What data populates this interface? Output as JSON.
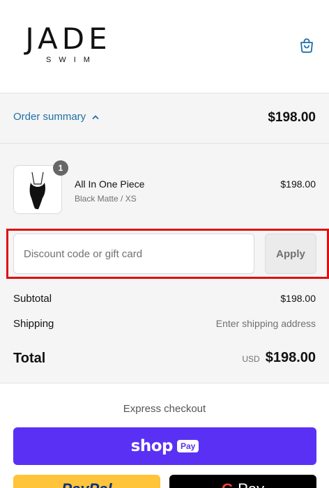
{
  "header": {
    "logo_main": "JADE",
    "logo_sub": "SWIM",
    "cart_icon": "shopping-bag-icon"
  },
  "summary": {
    "toggle_label": "Order summary",
    "toggle_icon": "chevron-up-icon",
    "total": "$198.00",
    "link_color": "#1f6fa8"
  },
  "product": {
    "quantity": "1",
    "name": "All In One Piece",
    "variant": "Black Matte / XS",
    "price": "$198.00",
    "image_icon": "swimsuit-icon"
  },
  "discount": {
    "placeholder": "Discount code or gift card",
    "apply_label": "Apply",
    "highlight_color": "#e01010"
  },
  "totals": {
    "subtotal_label": "Subtotal",
    "subtotal_value": "$198.00",
    "shipping_label": "Shipping",
    "shipping_value": "Enter shipping address",
    "total_label": "Total",
    "currency": "USD",
    "total_value": "$198.00"
  },
  "express": {
    "label": "Express checkout",
    "shop_word": "shop",
    "pay_badge": "Pay",
    "shop_pay_color": "#5a31f4",
    "paypal_label": "PayPal",
    "paypal_color": "#ffc439",
    "gpay_g": "G",
    "gpay_label": "Pay"
  }
}
